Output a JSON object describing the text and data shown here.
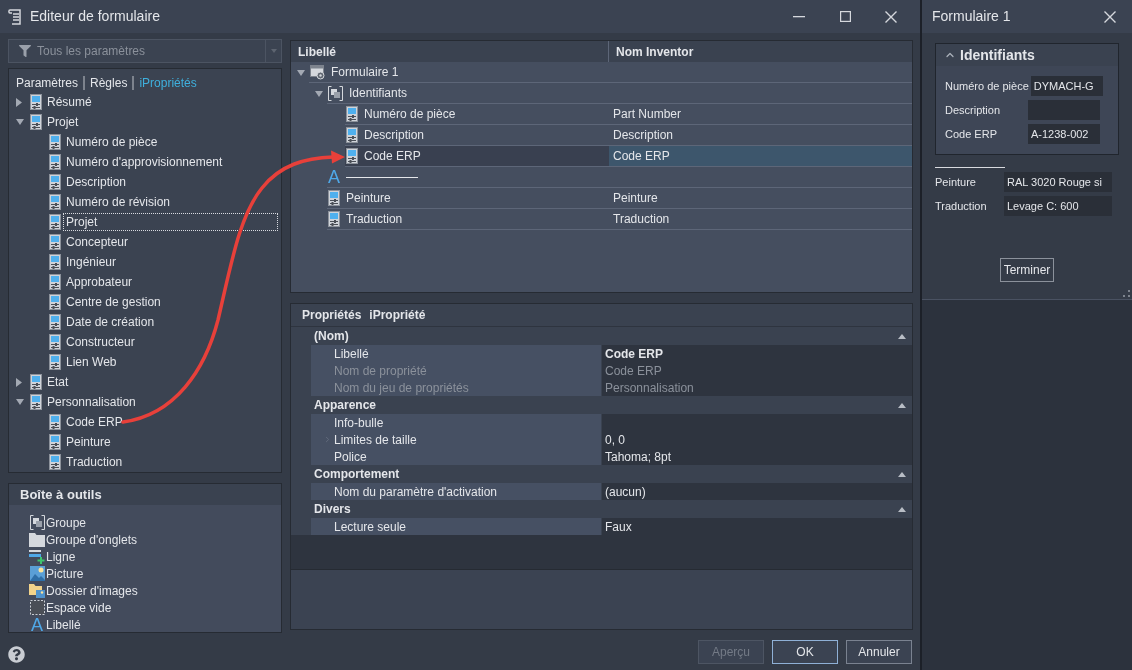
{
  "window": {
    "title": "Editeur de formulaire"
  },
  "filter": {
    "value": "Tous les paramètres"
  },
  "source_tabs": [
    {
      "label": "Paramètres",
      "selected": false
    },
    {
      "label": "Règles",
      "selected": false
    },
    {
      "label": "iPropriétés",
      "selected": true
    }
  ],
  "source_tree": [
    {
      "label": "Résumé",
      "expanded": false,
      "focused": false
    },
    {
      "label": "Projet",
      "expanded": true,
      "focused": false,
      "children": [
        {
          "label": "Numéro de pièce",
          "focused": false
        },
        {
          "label": "Numéro d'approvisionnement",
          "focused": false
        },
        {
          "label": "Description",
          "focused": false
        },
        {
          "label": "Numéro de révision",
          "focused": false
        },
        {
          "label": "Projet",
          "focused": true
        },
        {
          "label": "Concepteur",
          "focused": false
        },
        {
          "label": "Ingénieur",
          "focused": false
        },
        {
          "label": "Approbateur",
          "focused": false
        },
        {
          "label": "Centre de gestion",
          "focused": false
        },
        {
          "label": "Date de création",
          "focused": false
        },
        {
          "label": "Constructeur",
          "focused": false
        },
        {
          "label": "Lien Web",
          "focused": false
        }
      ]
    },
    {
      "label": "Etat",
      "expanded": false,
      "focused": false
    },
    {
      "label": "Personnalisation",
      "expanded": true,
      "focused": false,
      "children": [
        {
          "label": "Code ERP",
          "focused": false
        },
        {
          "label": "Peinture",
          "focused": false
        },
        {
          "label": "Traduction",
          "focused": false
        }
      ]
    }
  ],
  "toolbox": {
    "title": "Boîte à outils",
    "items": [
      {
        "kind": "group",
        "label": "Groupe"
      },
      {
        "kind": "tab_group",
        "label": "Groupe d'onglets"
      },
      {
        "kind": "row",
        "label": "Ligne"
      },
      {
        "kind": "picture",
        "label": "Picture"
      },
      {
        "kind": "image_folder",
        "label": "Dossier d'images"
      },
      {
        "kind": "spacer",
        "label": "Espace vide"
      },
      {
        "kind": "label",
        "icon": "A",
        "label": "Libellé"
      }
    ]
  },
  "form_tree": {
    "columns": [
      "Libellé",
      "Nom Inventor"
    ],
    "rows": [
      {
        "kind": "form",
        "label": "Formulaire 1",
        "expanded": true,
        "selected": false,
        "children": [
          {
            "kind": "group",
            "label": "Identifiants",
            "expanded": true,
            "selected": false,
            "children": [
              {
                "kind": "property",
                "label": "Numéro de pièce",
                "inventor_name": "Part Number",
                "selected": false
              },
              {
                "kind": "property",
                "label": "Description",
                "inventor_name": "Description",
                "selected": false
              },
              {
                "kind": "property",
                "label": "Code ERP",
                "inventor_name": "Code ERP",
                "selected": true
              }
            ]
          },
          {
            "kind": "label",
            "icon": "A",
            "selected": false
          },
          {
            "kind": "property",
            "label": "Peinture",
            "inventor_name": "Peinture",
            "selected": false
          },
          {
            "kind": "property",
            "label": "Traduction",
            "inventor_name": "Traduction",
            "selected": false
          }
        ]
      }
    ]
  },
  "properties": {
    "title": "Propriétés",
    "subject": "iPropriété",
    "categories": [
      {
        "name": "(Nom)",
        "expanded": true,
        "rows": [
          {
            "name": "Libellé",
            "value": "Code ERP",
            "modified": true,
            "disabled": false,
            "expandable": false
          },
          {
            "name": "Nom de propriété",
            "value": "Code ERP",
            "modified": false,
            "disabled": true,
            "expandable": false
          },
          {
            "name": "Nom du jeu de propriétés",
            "value": "Personnalisation",
            "modified": false,
            "disabled": true,
            "expandable": false
          }
        ]
      },
      {
        "name": "Apparence",
        "expanded": true,
        "rows": [
          {
            "name": "Info-bulle",
            "disabled": false,
            "expandable": false
          },
          {
            "name": "Limites de taille",
            "value": "0, 0",
            "modified": false,
            "disabled": false,
            "expandable": true
          },
          {
            "name": "Police",
            "value": "Tahoma; 8pt",
            "modified": false,
            "disabled": false,
            "expandable": false
          }
        ]
      },
      {
        "name": "Comportement",
        "expanded": true,
        "rows": [
          {
            "name": "Nom du paramètre d'activation",
            "value": "(aucun)",
            "modified": false,
            "disabled": false,
            "expandable": false
          }
        ]
      },
      {
        "name": "Divers",
        "expanded": true,
        "rows": [
          {
            "name": "Lecture seule",
            "value": "Faux",
            "modified": false,
            "disabled": false,
            "expandable": false
          }
        ]
      }
    ]
  },
  "buttons": [
    {
      "label": "Aperçu",
      "disabled": true,
      "default": false
    },
    {
      "label": "OK",
      "disabled": false,
      "default": true
    },
    {
      "label": "Annuler",
      "disabled": false,
      "default": false
    }
  ],
  "preview": {
    "title": "Formulaire 1",
    "items": [
      {
        "kind": "group",
        "title": "Identifiants",
        "expanded": true,
        "fields": [
          {
            "label": "Numéro de pièce",
            "value": "DYMACH-G"
          },
          {
            "label": "Description"
          },
          {
            "label": "Code ERP",
            "value": "A-1238-002"
          }
        ]
      },
      {
        "kind": "rule"
      },
      {
        "kind": "field",
        "label": "Peinture",
        "value": "RAL 3020 Rouge si"
      },
      {
        "kind": "field",
        "label": "Traduction",
        "value": "Levage C: 600"
      }
    ],
    "button": "Terminer"
  }
}
